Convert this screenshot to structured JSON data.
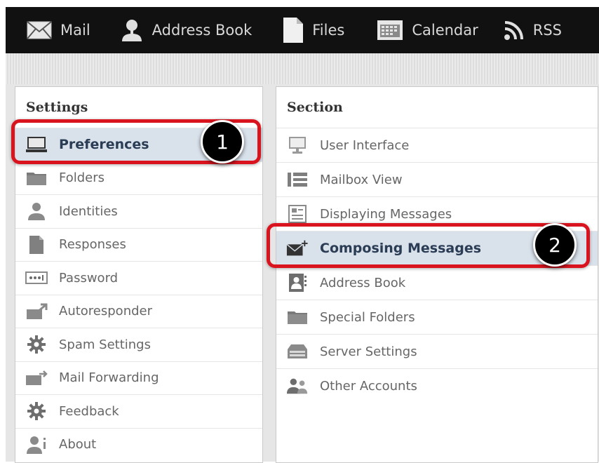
{
  "topnav": {
    "items": [
      {
        "label": "Mail",
        "icon": "envelope-icon"
      },
      {
        "label": "Address Book",
        "icon": "person-icon"
      },
      {
        "label": "Files",
        "icon": "file-icon"
      },
      {
        "label": "Calendar",
        "icon": "calendar-icon"
      },
      {
        "label": "RSS",
        "icon": "rss-icon"
      }
    ]
  },
  "settings": {
    "title": "Settings",
    "items": [
      {
        "label": "Preferences",
        "icon": "monitor-icon",
        "selected": true
      },
      {
        "label": "Folders",
        "icon": "folder-icon"
      },
      {
        "label": "Identities",
        "icon": "person-icon"
      },
      {
        "label": "Responses",
        "icon": "document-icon"
      },
      {
        "label": "Password",
        "icon": "password-icon"
      },
      {
        "label": "Autoresponder",
        "icon": "autoresponder-icon"
      },
      {
        "label": "Spam Settings",
        "icon": "gear-icon"
      },
      {
        "label": "Mail Forwarding",
        "icon": "forward-mail-icon"
      },
      {
        "label": "Feedback",
        "icon": "gear-icon"
      },
      {
        "label": "About",
        "icon": "person-info-icon"
      }
    ]
  },
  "section": {
    "title": "Section",
    "items": [
      {
        "label": "User Interface",
        "icon": "monitor-icon"
      },
      {
        "label": "Mailbox View",
        "icon": "list-icon"
      },
      {
        "label": "Displaying Messages",
        "icon": "message-view-icon"
      },
      {
        "label": "Composing Messages",
        "icon": "compose-mail-icon",
        "selected": true
      },
      {
        "label": "Address Book",
        "icon": "address-book-icon"
      },
      {
        "label": "Special Folders",
        "icon": "folder-icon"
      },
      {
        "label": "Server Settings",
        "icon": "server-icon"
      },
      {
        "label": "Other Accounts",
        "icon": "people-icon"
      }
    ]
  },
  "callouts": {
    "first": "1",
    "second": "2"
  },
  "colors": {
    "accent_red": "#d9141e",
    "selected_row": "#d9e1eb",
    "topbar": "#111111"
  }
}
